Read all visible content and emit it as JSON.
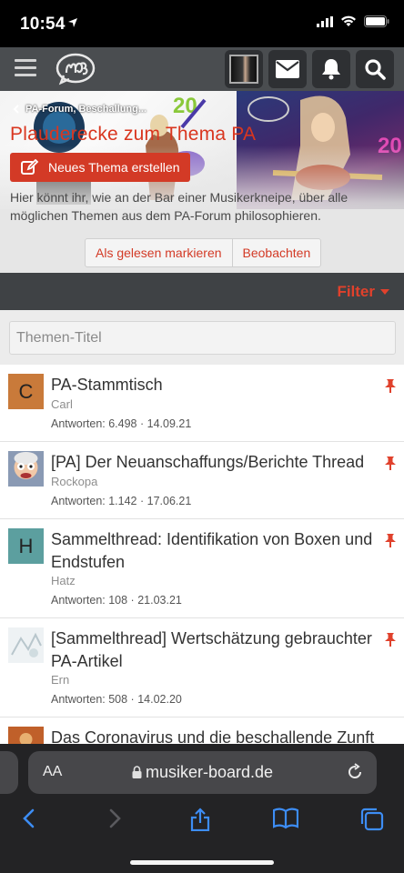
{
  "status_bar": {
    "time": "10:54"
  },
  "header": {
    "menu_icon": "hamburger-icon",
    "logo_icon": "musiker-board-logo",
    "actions": [
      "avatar",
      "envelope-icon",
      "bell-icon",
      "search-icon"
    ]
  },
  "banner": {
    "breadcrumb": "PA-Forum, Beschallung...",
    "title": "Plauderecke zum Thema PA",
    "new_thread_label": "Neues Thema erstellen",
    "description": "Hier könnt ihr, wie an der Bar einer Musikerkneipe, über alle möglichen Themen aus dem PA-Forum philosophieren.",
    "mark_read_label": "Als gelesen markieren",
    "watch_label": "Beobachten"
  },
  "filter": {
    "label": "Filter"
  },
  "search": {
    "placeholder": "Themen-Titel"
  },
  "threads": [
    {
      "avatar_letter": "C",
      "avatar_color": "#c97a3a",
      "title": "PA-Stammtisch",
      "author": "Carl",
      "meta": "Antworten: 6.498 · 14.09.21",
      "pinned": true
    },
    {
      "avatar_letter": "",
      "avatar_color": "#b0a090",
      "title": "[PA] Der Neuanschaffungs/Berichte Thread",
      "author": "Rockopa",
      "meta": "Antworten: 1.142 · 17.06.21",
      "pinned": true
    },
    {
      "avatar_letter": "H",
      "avatar_color": "#5c9f9f",
      "title": "Sammelthread: Identifikation von Boxen und Endstufen",
      "author": "Hatz",
      "meta": "Antworten: 108 · 21.03.21",
      "pinned": true
    },
    {
      "avatar_letter": "",
      "avatar_color": "#dfe6ea",
      "title": "[Sammelthread] Wertschätzung gebrauchter PA-Artikel",
      "author": "Ern",
      "meta": "Antworten: 508 · 14.02.20",
      "pinned": true
    },
    {
      "avatar_letter": "",
      "avatar_color": "#c0602a",
      "title": "Das Coronavirus und die beschallende Zunft",
      "author": "",
      "meta": "",
      "pinned": false
    }
  ],
  "browser": {
    "text_size_label": "AA",
    "url": "musiker-board.de",
    "toolbar": [
      "back-icon",
      "forward-icon",
      "share-icon",
      "bookmarks-icon",
      "tabs-icon"
    ]
  }
}
